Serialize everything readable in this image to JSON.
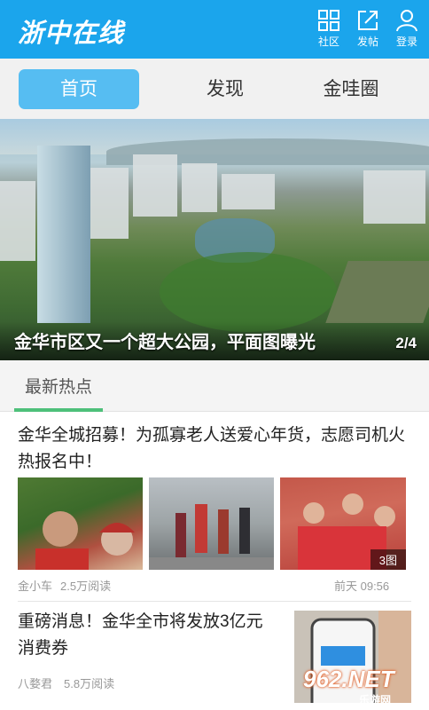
{
  "header": {
    "logo": "浙中在线",
    "buttons": [
      {
        "label": "社区",
        "icon": "grid-icon"
      },
      {
        "label": "发帖",
        "icon": "share-icon"
      },
      {
        "label": "登录",
        "icon": "user-icon"
      }
    ]
  },
  "tabs": [
    {
      "label": "首页",
      "active": true
    },
    {
      "label": "发现",
      "active": false
    },
    {
      "label": "金哇圈",
      "active": false
    }
  ],
  "banner": {
    "caption": "金华市区又一个超大公园，平面图曝光",
    "pager": "2/4"
  },
  "section": {
    "title": "最新热点"
  },
  "feed": [
    {
      "title": "金华全城招募！为孤寡老人送爱心年货，志愿司机火热报名中！",
      "images_badge": "3图",
      "author": "金小车",
      "reads": "2.5万阅读",
      "time": "前天 09:56"
    },
    {
      "title": "重磅消息！金华全市将发放3亿元消费券",
      "author": "八婺君",
      "reads": "5.8万阅读",
      "watermark": "962.NET",
      "watermark_sub": "乐游网"
    }
  ],
  "colors": {
    "brand": "#1ba5ec",
    "tab_active": "#56bdf2",
    "accent_line": "#4ec07a"
  }
}
